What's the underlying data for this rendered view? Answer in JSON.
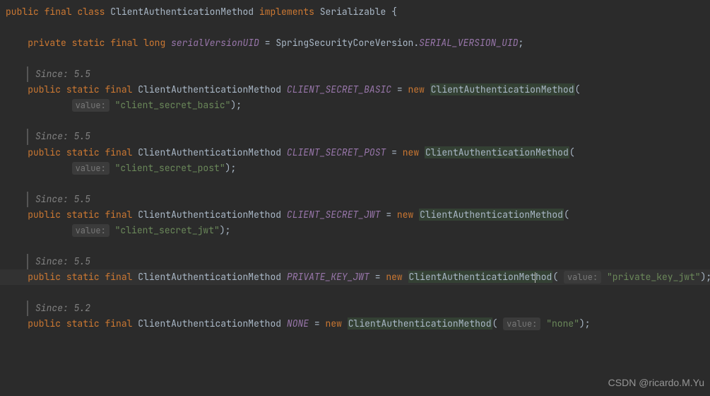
{
  "header": {
    "kw_public": "public",
    "kw_final": "final",
    "kw_class": "class",
    "class_name": "ClientAuthenticationMethod",
    "kw_implements": "implements",
    "iface": "Serializable",
    "brace": " {"
  },
  "svu": {
    "kw_private": "private",
    "kw_static": "static",
    "kw_final": "final",
    "kw_long": "long",
    "field": "serialVersionUID",
    "eq": " = ",
    "qual": "SpringSecurityCoreVersion",
    "dot": ".",
    "const": "SERIAL_VERSION_UID",
    "semi": ";"
  },
  "doc": {
    "since55": "Since: 5.5",
    "since52": "Since: 5.2"
  },
  "psf": {
    "kw_public": "public",
    "kw_static": "static",
    "kw_final": "final",
    "type": "ClientAuthenticationMethod"
  },
  "common": {
    "eq": " = ",
    "kw_new": "new",
    "ctor": "ClientAuthenticationMethod",
    "open": "(",
    "close_semi": ");",
    "hint_value": "value:"
  },
  "f1": {
    "name": "CLIENT_SECRET_BASIC",
    "val": "\"client_secret_basic\""
  },
  "f2": {
    "name": "CLIENT_SECRET_POST",
    "val": "\"client_secret_post\""
  },
  "f3": {
    "name": "CLIENT_SECRET_JWT",
    "val": "\"client_secret_jwt\""
  },
  "f4": {
    "name": "PRIVATE_KEY_JWT",
    "val": "\"private_key_jwt\""
  },
  "f5": {
    "name": "NONE",
    "val": "\"none\""
  },
  "watermark": "CSDN @ricardo.M.Yu"
}
